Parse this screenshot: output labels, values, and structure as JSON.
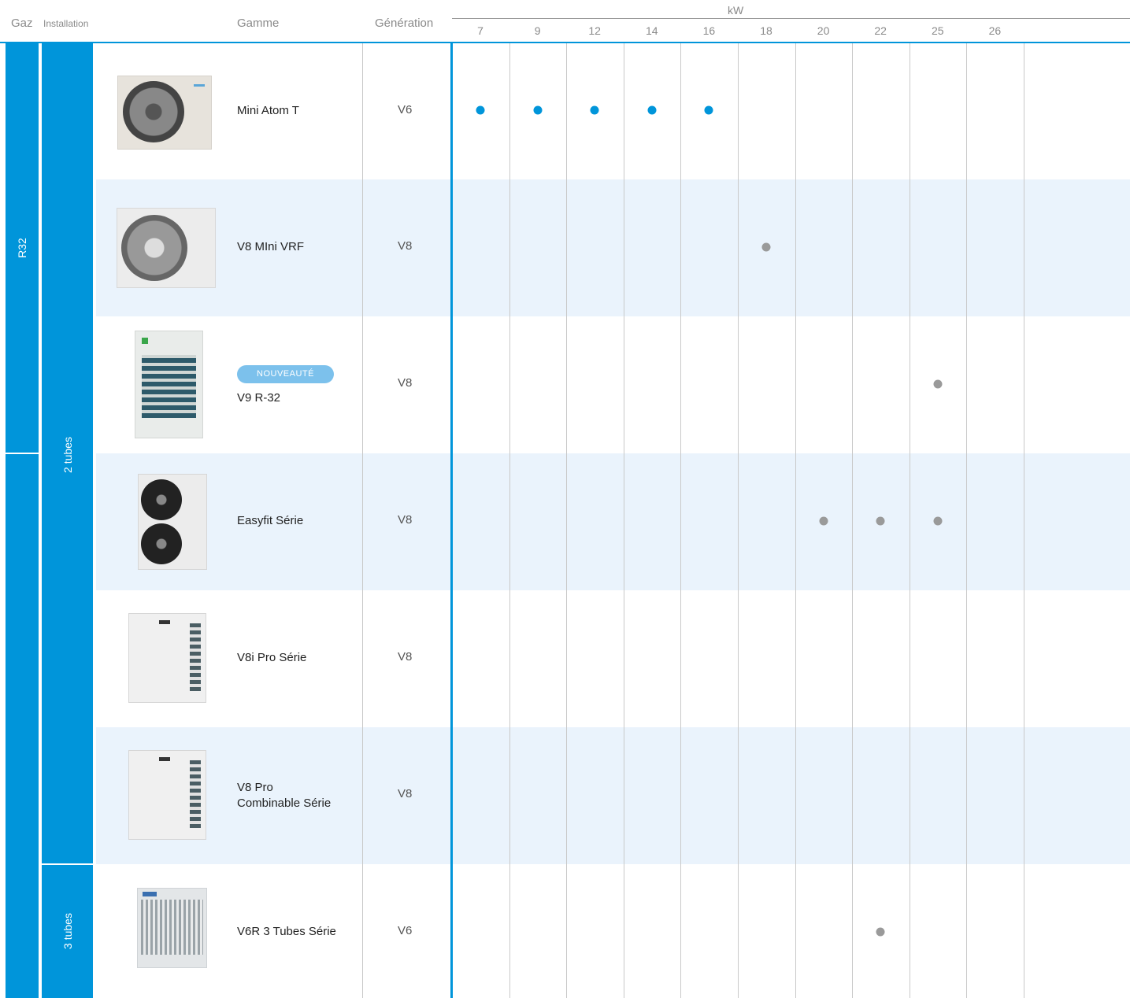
{
  "header": {
    "gaz": "Gaz",
    "installation": "Installation",
    "gamme": "Gamme",
    "generation": "Génération",
    "unit": "kW",
    "columns": [
      "7",
      "9",
      "12",
      "14",
      "16",
      "18",
      "20",
      "22",
      "25",
      "26"
    ]
  },
  "gas": {
    "r32": "R32"
  },
  "installation": {
    "two_tubes": "2 tubes",
    "three_tubes": "3 tubes"
  },
  "rows": [
    {
      "name": "Mini Atom T",
      "generation": "V6",
      "available_kw": [
        "7",
        "9",
        "12",
        "14",
        "16"
      ],
      "dot_color": "#0095da"
    },
    {
      "name": "V8 MIni VRF",
      "generation": "V8",
      "available_kw": [
        "18"
      ],
      "dot_color": "#9a9a9a"
    },
    {
      "badge": "NOUVEAUTÉ",
      "name": "V9 R-32",
      "generation": "V8",
      "available_kw": [
        "25"
      ],
      "dot_color": "#9a9a9a"
    },
    {
      "name": "Easyfit Série",
      "generation": "V8",
      "available_kw": [
        "20",
        "22",
        "25"
      ],
      "dot_color": "#9a9a9a"
    },
    {
      "name": "V8i Pro Série",
      "generation": "V8",
      "available_kw": [],
      "dot_color": "#9a9a9a"
    },
    {
      "name_line1": "V8 Pro",
      "name_line2": "Combinable Série",
      "generation": "V8",
      "available_kw": [],
      "dot_color": "#9a9a9a"
    },
    {
      "name": "V6R 3 Tubes Série",
      "generation": "V6",
      "available_kw": [
        "22"
      ],
      "dot_color": "#9a9a9a"
    }
  ],
  "colors": {
    "accent": "#0095da",
    "band": "#eaf3fc",
    "inactive_dot": "#9a9a9a"
  }
}
